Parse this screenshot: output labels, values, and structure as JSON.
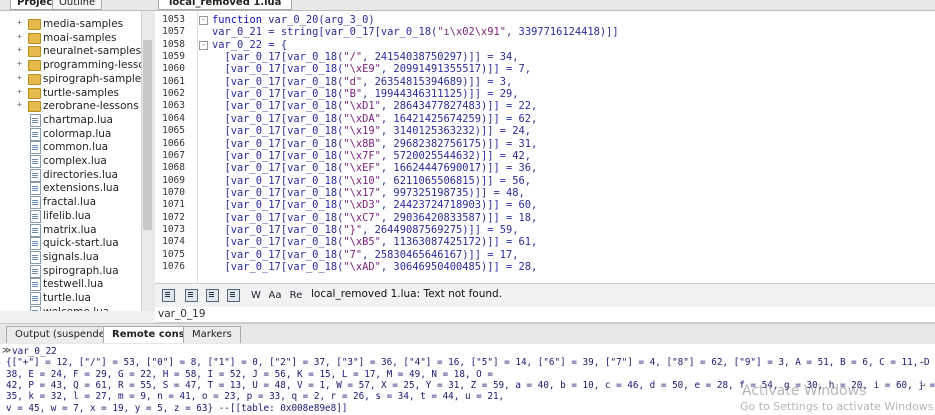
{
  "left_panel": {
    "tabs": [
      {
        "label": "Project",
        "active": true
      },
      {
        "label": "Outline",
        "active": false
      }
    ],
    "tree": [
      {
        "type": "folder",
        "label": "media-samples"
      },
      {
        "type": "folder",
        "label": "moai-samples"
      },
      {
        "type": "folder",
        "label": "neuralnet-samples"
      },
      {
        "type": "folder",
        "label": "programming-lessons"
      },
      {
        "type": "folder",
        "label": "spirograph-samples"
      },
      {
        "type": "folder",
        "label": "turtle-samples"
      },
      {
        "type": "folder",
        "label": "zerobrane-lessons"
      },
      {
        "type": "file",
        "label": "chartmap.lua"
      },
      {
        "type": "file",
        "label": "colormap.lua"
      },
      {
        "type": "file",
        "label": "common.lua"
      },
      {
        "type": "file",
        "label": "complex.lua"
      },
      {
        "type": "file",
        "label": "directories.lua"
      },
      {
        "type": "file",
        "label": "extensions.lua"
      },
      {
        "type": "file",
        "label": "fractal.lua"
      },
      {
        "type": "file",
        "label": "lifelib.lua"
      },
      {
        "type": "file",
        "label": "matrix.lua"
      },
      {
        "type": "file",
        "label": "quick-start.lua"
      },
      {
        "type": "file",
        "label": "signals.lua"
      },
      {
        "type": "file",
        "label": "spirograph.lua"
      },
      {
        "type": "file",
        "label": "testwell.lua"
      },
      {
        "type": "file",
        "label": "turtle.lua"
      },
      {
        "type": "file",
        "label": "welcome.lua"
      }
    ]
  },
  "editor": {
    "tab_label": "local_removed 1.lua",
    "lines": [
      {
        "n": "1053",
        "fold": "-",
        "code": "function var_0_20(arg_3_0)"
      },
      {
        "n": "1057",
        "fold": "",
        "code": "var_0_21 = string[var_0_17[var_0_18(\"ı\\x02\\x91\", 3397716124418)]]"
      },
      {
        "n": "1058",
        "fold": "-",
        "code": "var_0_22 = {"
      },
      {
        "n": "1059",
        "fold": "",
        "code": "  [var_0_17[var_0_18(\"/\", 24154038750297)]] = 34,"
      },
      {
        "n": "1060",
        "fold": "",
        "code": "  [var_0_17[var_0_18(\"\\xE9\", 20991491355517)]] = 7,"
      },
      {
        "n": "1061",
        "fold": "",
        "code": "  [var_0_17[var_0_18(\"d\", 26354815394689)]] = 3,"
      },
      {
        "n": "1062",
        "fold": "",
        "code": "  [var_0_17[var_0_18(\"B\", 19944346311125)]] = 29,"
      },
      {
        "n": "1063",
        "fold": "",
        "code": "  [var_0_17[var_0_18(\"\\xD1\", 28643477827483)]] = 22,"
      },
      {
        "n": "1064",
        "fold": "",
        "code": "  [var_0_17[var_0_18(\"\\xDA\", 16421425674259)]] = 62,"
      },
      {
        "n": "1065",
        "fold": "",
        "code": "  [var_0_17[var_0_18(\"\\x19\", 3140125363232)]] = 24,"
      },
      {
        "n": "1066",
        "fold": "",
        "code": "  [var_0_17[var_0_18(\"\\x8B\", 29682382756175)]] = 31,"
      },
      {
        "n": "1067",
        "fold": "",
        "code": "  [var_0_17[var_0_18(\"\\x7F\", 5720025544632)]] = 42,"
      },
      {
        "n": "1068",
        "fold": "",
        "code": "  [var_0_17[var_0_18(\"\\xEF\", 16624447690017)]] = 36,"
      },
      {
        "n": "1069",
        "fold": "",
        "code": "  [var_0_17[var_0_18(\"\\x10\", 6211065506815)]] = 56,"
      },
      {
        "n": "1070",
        "fold": "",
        "code": "  [var_0_17[var_0_18(\"\\x17\", 997325198735)]] = 48,"
      },
      {
        "n": "1071",
        "fold": "",
        "code": "  [var_0_17[var_0_18(\"\\xD3\", 24423724718903)]] = 60,"
      },
      {
        "n": "1072",
        "fold": "",
        "code": "  [var_0_17[var_0_18(\"\\xC7\", 29036420833587)]] = 18,"
      },
      {
        "n": "1073",
        "fold": "",
        "code": "  [var_0_17[var_0_18(\"}\", 26449087569275)]] = 59,"
      },
      {
        "n": "1074",
        "fold": "",
        "code": "  [var_0_17[var_0_18(\"\\xB5\", 11363087425172)]] = 61,"
      },
      {
        "n": "1075",
        "fold": "",
        "code": "  [var_0_17[var_0_18(\"7\", 25830465646167)]] = 17,"
      },
      {
        "n": "1076",
        "fold": "",
        "code": "  [var_0_17[var_0_18(\"\\xAD\", 30646950400485)]] = 28,"
      }
    ]
  },
  "findbar": {
    "buttons": [
      "W",
      "Aa",
      "Re"
    ],
    "message": "local_removed 1.lua: Text not found.",
    "input_value": "var_0_19"
  },
  "bottom_tabs": [
    {
      "label": "Output (suspended)",
      "active": false
    },
    {
      "label": "Remote console",
      "active": true
    },
    {
      "label": "Markers",
      "active": false
    }
  ],
  "console": {
    "lines": [
      "var_0_22",
      "{[\"+\"] = 12, [\"/\"] = 53, [\"0\"] = 8, [\"1\"] = 0, [\"2\"] = 37, [\"3\"] = 36, [\"4\"] = 16, [\"5\"] = 14, [\"6\"] = 39, [\"7\"] = 4, [\"8\"] = 62, [\"9\"] = 3, A = 51, B = 6, C = 11, D =",
      "38, E = 24, F = 29, G = 22, H = 58, I = 52, J = 56, K = 15, L = 17, M = 49, N = 18, O =",
      "42, P = 43, Q = 61, R = 55, S = 47, T = 13, U = 48, V = 1, W = 57, X = 25, Y = 31, Z = 59, a = 40, b = 10, c = 46, d = 50, e = 28, f = 54, g = 30, h = 20, i = 60, j =",
      "35, k = 32, l = 27, m = 9, n = 41, o = 23, p = 33, q = 2, r = 26, s = 34, t = 44, u = 21,",
      "v = 45, w = 7, x = 19, y = 5, z = 63} --[[table: 0x008e89e8]]"
    ],
    "wrap_marks": [
      1,
      3
    ]
  },
  "watermark": {
    "line1": "Activate Windows",
    "line2": "Go to Settings to activate Windows."
  },
  "icons": {
    "plus": "expand-plus-icon",
    "folder": "folder-icon",
    "file": "lua-file-icon",
    "wrap": "line-wrap-icon"
  },
  "colors": {
    "keyword": "#1010b0",
    "code": "#2b2b9c",
    "console": "#1a1a70",
    "folder": "#e6b94c"
  }
}
